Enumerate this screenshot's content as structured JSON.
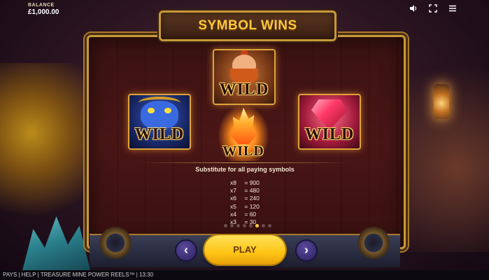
{
  "balance": {
    "label": "BALANCE",
    "value": "£1,000.00"
  },
  "top_icons": [
    "speaker-icon",
    "fullscreen-icon",
    "menu-icon"
  ],
  "title": "SYMBOL WINS",
  "symbols": {
    "dwarf": {
      "label": "WILD"
    },
    "monster": {
      "label": "WILD"
    },
    "fire": {
      "label": "WILD"
    },
    "gem": {
      "label": "WILD"
    }
  },
  "description": "Substitute for all paying symbols",
  "paytable": [
    {
      "count": "x8",
      "value": "= 900"
    },
    {
      "count": "x7",
      "value": "= 480"
    },
    {
      "count": "x6",
      "value": "= 240"
    },
    {
      "count": "x5",
      "value": "= 120"
    },
    {
      "count": "x4",
      "value": "= 60"
    },
    {
      "count": "x3",
      "value": "= 30"
    }
  ],
  "pager": {
    "pages": 8,
    "active": 5
  },
  "controls": {
    "prev": "‹",
    "play": "PLAY",
    "next": "›"
  },
  "footer": {
    "pays": "PAYS",
    "sep": " | ",
    "help": "HELP",
    "game": "TREASURE MINE POWER REELS™",
    "time": "13:30"
  }
}
